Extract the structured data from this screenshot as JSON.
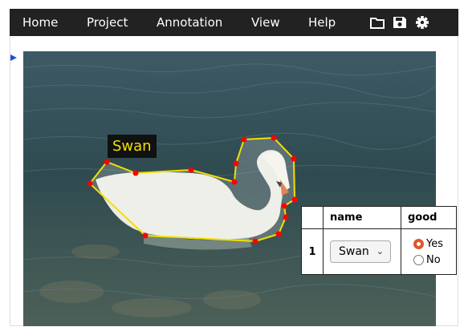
{
  "menu": {
    "items": [
      {
        "label": "Home"
      },
      {
        "label": "Project"
      },
      {
        "label": "Annotation"
      },
      {
        "label": "View"
      },
      {
        "label": "Help"
      }
    ]
  },
  "toolbar": {
    "icons": [
      "folder-icon",
      "save-icon",
      "gear-icon"
    ]
  },
  "region": {
    "label": "Swan"
  },
  "attributes": {
    "headers": [
      "",
      "name",
      "good"
    ],
    "row": {
      "id": "1",
      "name_value": "Swan",
      "good_options": [
        {
          "label": "Yes",
          "selected": true
        },
        {
          "label": "No",
          "selected": false
        }
      ]
    }
  },
  "colors": {
    "menubar": "#222222",
    "polygon": "#f0e000",
    "vertex": "#ff0000",
    "radio_selected": "#e0562a"
  }
}
